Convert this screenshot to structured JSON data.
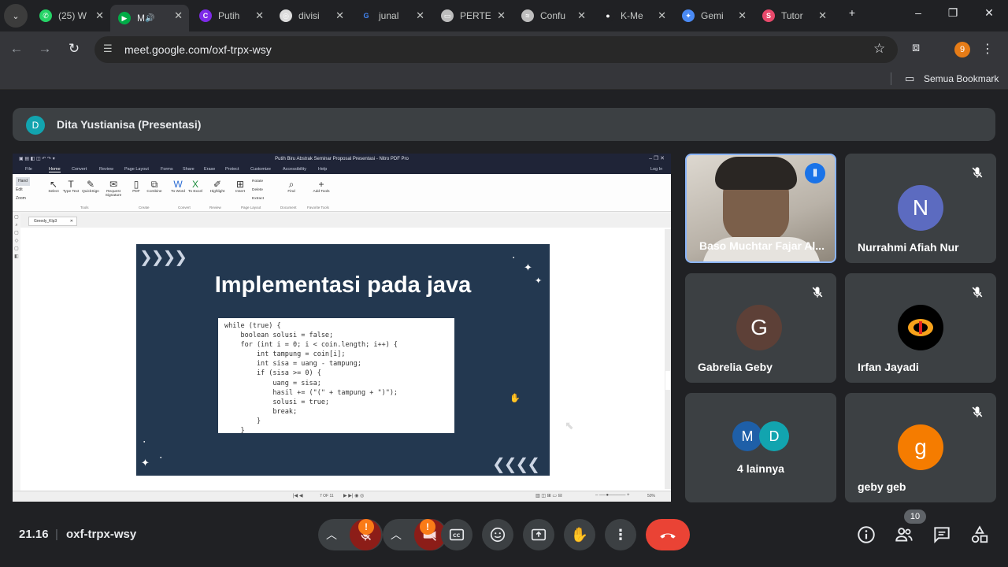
{
  "browser": {
    "tabs": [
      {
        "label": "(25) W",
        "fav": "whatsapp-icon",
        "color": "#25d366"
      },
      {
        "label": "M",
        "fav": "meet-icon",
        "color": "#00ac47"
      },
      {
        "label": "Putih",
        "fav": "canva-icon",
        "color": "#7d2ae8"
      },
      {
        "label": "divisi",
        "fav": "chrome-icon",
        "color": "#dcdcdc"
      },
      {
        "label": "junal",
        "fav": "google-icon",
        "color": "#ffffff"
      },
      {
        "label": "PERTE",
        "fav": "slides-icon",
        "color": "#bdbdbd"
      },
      {
        "label": "Confu",
        "fav": "confluence-icon",
        "color": "#bdbdbd"
      },
      {
        "label": "K-Me",
        "fav": "github-icon",
        "color": "#ffffff"
      },
      {
        "label": "Gemi",
        "fav": "gemini-icon",
        "color": "#4a8af4"
      },
      {
        "label": "Tutor",
        "fav": "tutor-icon",
        "color": "#e8496b"
      }
    ],
    "url": "meet.google.com/oxf-trpx-wsy",
    "profile_initial": "9",
    "bookmarks_label": "Semua Bookmark"
  },
  "meet": {
    "presenter_initial": "D",
    "presenter_label": "Dita Yustianisa (Presentasi)",
    "time": "21.16",
    "meeting_code": "oxf-trpx-wsy",
    "people_count": "10",
    "participants": [
      {
        "name": "Baso Muchtar Fajar Al...",
        "initial": "",
        "color": ""
      },
      {
        "name": "Nurrahmi Afiah Nur",
        "initial": "N",
        "color": "#5c6bc0"
      },
      {
        "name": "Gabrelia Geby",
        "initial": "G",
        "color": "#5d4037"
      },
      {
        "name": "Irfan Jayadi",
        "initial": "",
        "color": "#000000"
      },
      {
        "name": "4 lainnya",
        "initial": "",
        "color": ""
      },
      {
        "name": "geby geb",
        "initial": "g",
        "color": "#f57c00"
      }
    ],
    "others_initials": [
      "M",
      "D"
    ],
    "alert_badge": "!"
  },
  "shared_screen": {
    "window_title": "Putih Biru Abstrak Seminar Proposal Presentasi - Nitro PDF Pro",
    "menus": [
      "File",
      "Home",
      "Convert",
      "Review",
      "Page Layout",
      "Forms",
      "Share",
      "Erase",
      "Protect",
      "Customize",
      "Accessibility",
      "Help"
    ],
    "login": "Log In",
    "ribbon_buttons": [
      {
        "label": "Select",
        "icon": "↖"
      },
      {
        "label": "Type Text",
        "icon": "T"
      },
      {
        "label": "QuickSign",
        "icon": "✎"
      },
      {
        "label": "Request Signature",
        "icon": "✉"
      },
      {
        "label": "PDF",
        "icon": "▯"
      },
      {
        "label": "Combine",
        "icon": "⧉"
      },
      {
        "label": "To Word",
        "icon": "W"
      },
      {
        "label": "To Excel",
        "icon": "X"
      },
      {
        "label": "Highlight",
        "icon": "✐"
      },
      {
        "label": "Insert",
        "icon": "⊞"
      },
      {
        "label": "Find",
        "icon": "⌕"
      },
      {
        "label": "Add Tools",
        "icon": "+"
      }
    ],
    "ribbon_left": [
      "Hand",
      "Edit",
      "Zoom"
    ],
    "ribbon_mini": [
      "Rotate",
      "Delete",
      "Extract"
    ],
    "groups": [
      "Tools",
      "Create",
      "Convert",
      "Review",
      "Page Layout",
      "Document",
      "Favorite Tools"
    ],
    "doc_tab": "Greedy_Klp3",
    "page_indicator": "7 OF 11",
    "zoom": "50%",
    "slide_title": "Implementasi pada java",
    "code_lines": [
      "while (true) {",
      "    boolean solusi = false;",
      "    for (int i = 0; i < coin.length; i++) {",
      "        int tampung = coin[i];",
      "        int sisa = uang - tampung;",
      "        if (sisa >= 0) {",
      "            uang = sisa;",
      "            hasil += (\"(\" + tampung + \")\");",
      "            solusi = true;",
      "            break;",
      "        }",
      "    }"
    ]
  }
}
